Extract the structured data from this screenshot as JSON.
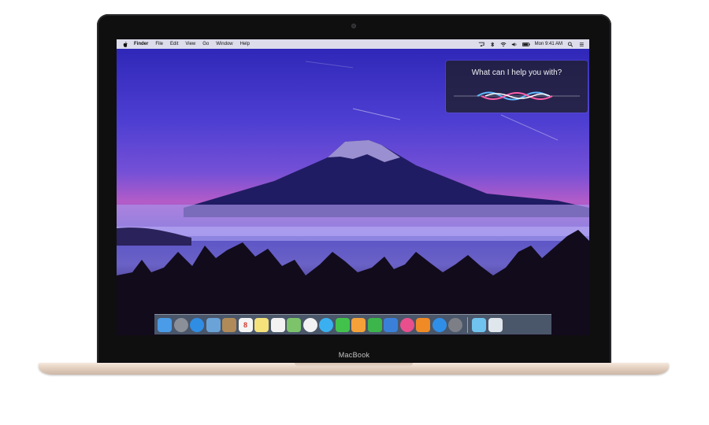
{
  "device": {
    "brand_label": "MacBook"
  },
  "menubar": {
    "items": [
      "Finder",
      "File",
      "Edit",
      "View",
      "Go",
      "Window",
      "Help"
    ],
    "clock": "Mon 9:41 AM"
  },
  "siri": {
    "prompt": "What can I help you with?"
  },
  "dock": {
    "apps": [
      {
        "name": "finder-icon",
        "color": "#4a9be8"
      },
      {
        "name": "launchpad-icon",
        "color": "#8a8f98"
      },
      {
        "name": "safari-icon",
        "color": "#2f8de4"
      },
      {
        "name": "mail-icon",
        "color": "#6aa3d8"
      },
      {
        "name": "contacts-icon",
        "color": "#b08a58"
      },
      {
        "name": "calendar-icon",
        "color": "#f4f4f4",
        "text": "8"
      },
      {
        "name": "notes-icon",
        "color": "#f5e27a"
      },
      {
        "name": "reminders-icon",
        "color": "#f2f2f2"
      },
      {
        "name": "maps-icon",
        "color": "#7cc36a"
      },
      {
        "name": "photos-icon",
        "color": "#f2f2f2"
      },
      {
        "name": "messages-icon",
        "color": "#3ab0f0"
      },
      {
        "name": "facetime-icon",
        "color": "#43c24b"
      },
      {
        "name": "pages-icon",
        "color": "#f4a13a"
      },
      {
        "name": "numbers-icon",
        "color": "#3cb54a"
      },
      {
        "name": "keynote-icon",
        "color": "#3a80d9"
      },
      {
        "name": "itunes-icon",
        "color": "#e84f8c"
      },
      {
        "name": "ibooks-icon",
        "color": "#f08a24"
      },
      {
        "name": "app-store-icon",
        "color": "#2f8fe8"
      },
      {
        "name": "system-preferences-icon",
        "color": "#7c7f86"
      }
    ],
    "trailing": [
      {
        "name": "downloads-folder-icon",
        "color": "#6fc3ee"
      },
      {
        "name": "trash-icon",
        "color": "#dfe6ec"
      }
    ]
  }
}
